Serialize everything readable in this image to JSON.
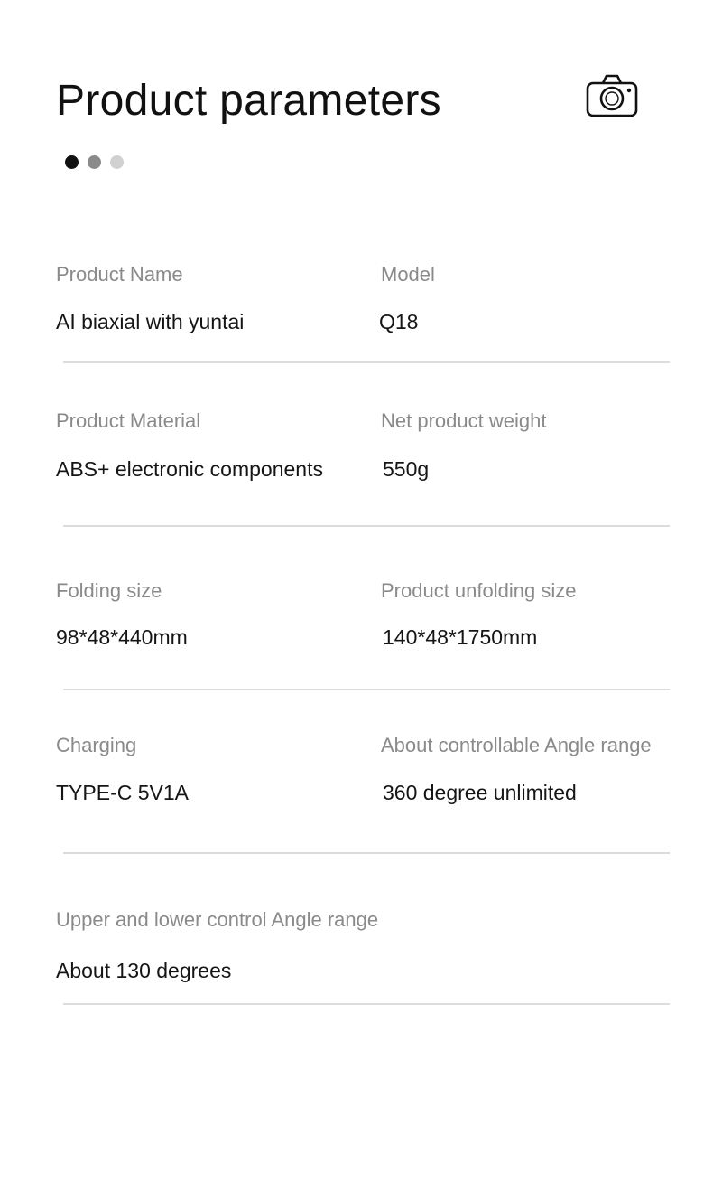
{
  "header": {
    "title": "Product parameters",
    "icon": "camera-icon"
  },
  "pagination": {
    "dot_colors": [
      "#111111",
      "#8a8a8a",
      "#d0d0d0"
    ]
  },
  "params": [
    {
      "left_label": "Product Name",
      "left_value": "AI biaxial with yuntai",
      "right_label": "Model",
      "right_value": "Q18"
    },
    {
      "left_label": "Product Material",
      "left_value": "ABS+ electronic components",
      "right_label": "Net product weight",
      "right_value": "550g"
    },
    {
      "left_label": "Folding size",
      "left_value": "98*48*440mm",
      "right_label": "Product unfolding size",
      "right_value": "140*48*1750mm"
    },
    {
      "left_label": "Charging",
      "left_value": "TYPE-C 5V1A",
      "right_label": "About controllable Angle range",
      "right_value": "360 degree unlimited"
    },
    {
      "left_label": "Upper and lower control Angle range",
      "left_value": "About 130 degrees"
    }
  ]
}
